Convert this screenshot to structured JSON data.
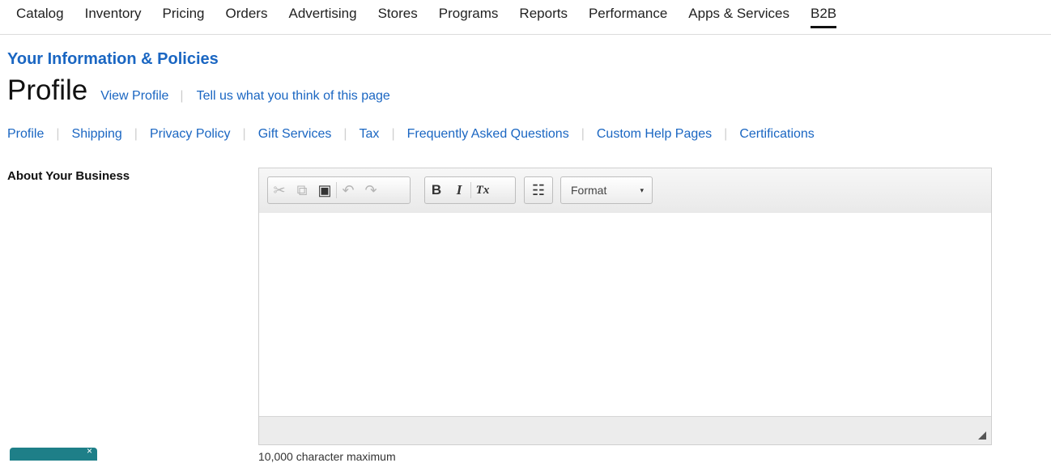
{
  "topnav": {
    "items": [
      "Catalog",
      "Inventory",
      "Pricing",
      "Orders",
      "Advertising",
      "Stores",
      "Programs",
      "Reports",
      "Performance",
      "Apps & Services",
      "B2B"
    ],
    "active": "B2B"
  },
  "section_title": "Your Information & Policies",
  "page_title": "Profile",
  "title_links": {
    "view_profile": "View Profile",
    "feedback": "Tell us what you think of this page"
  },
  "subnav": [
    "Profile",
    "Shipping",
    "Privacy Policy",
    "Gift Services",
    "Tax",
    "Frequently Asked Questions",
    "Custom Help Pages",
    "Certifications"
  ],
  "about_label": "About Your Business",
  "editor": {
    "toolbar": {
      "cut": "✂",
      "copy": "⧉",
      "paste": "▣",
      "undo": "↶",
      "redo": "↷",
      "bold": "B",
      "italic": "I",
      "clear_format": "Tx",
      "list": "☷",
      "format_label": "Format",
      "format_caret": "▾"
    },
    "content": ""
  },
  "feedback_tab": {
    "close": "×"
  },
  "char_limit_text": "10,000 character maximum"
}
